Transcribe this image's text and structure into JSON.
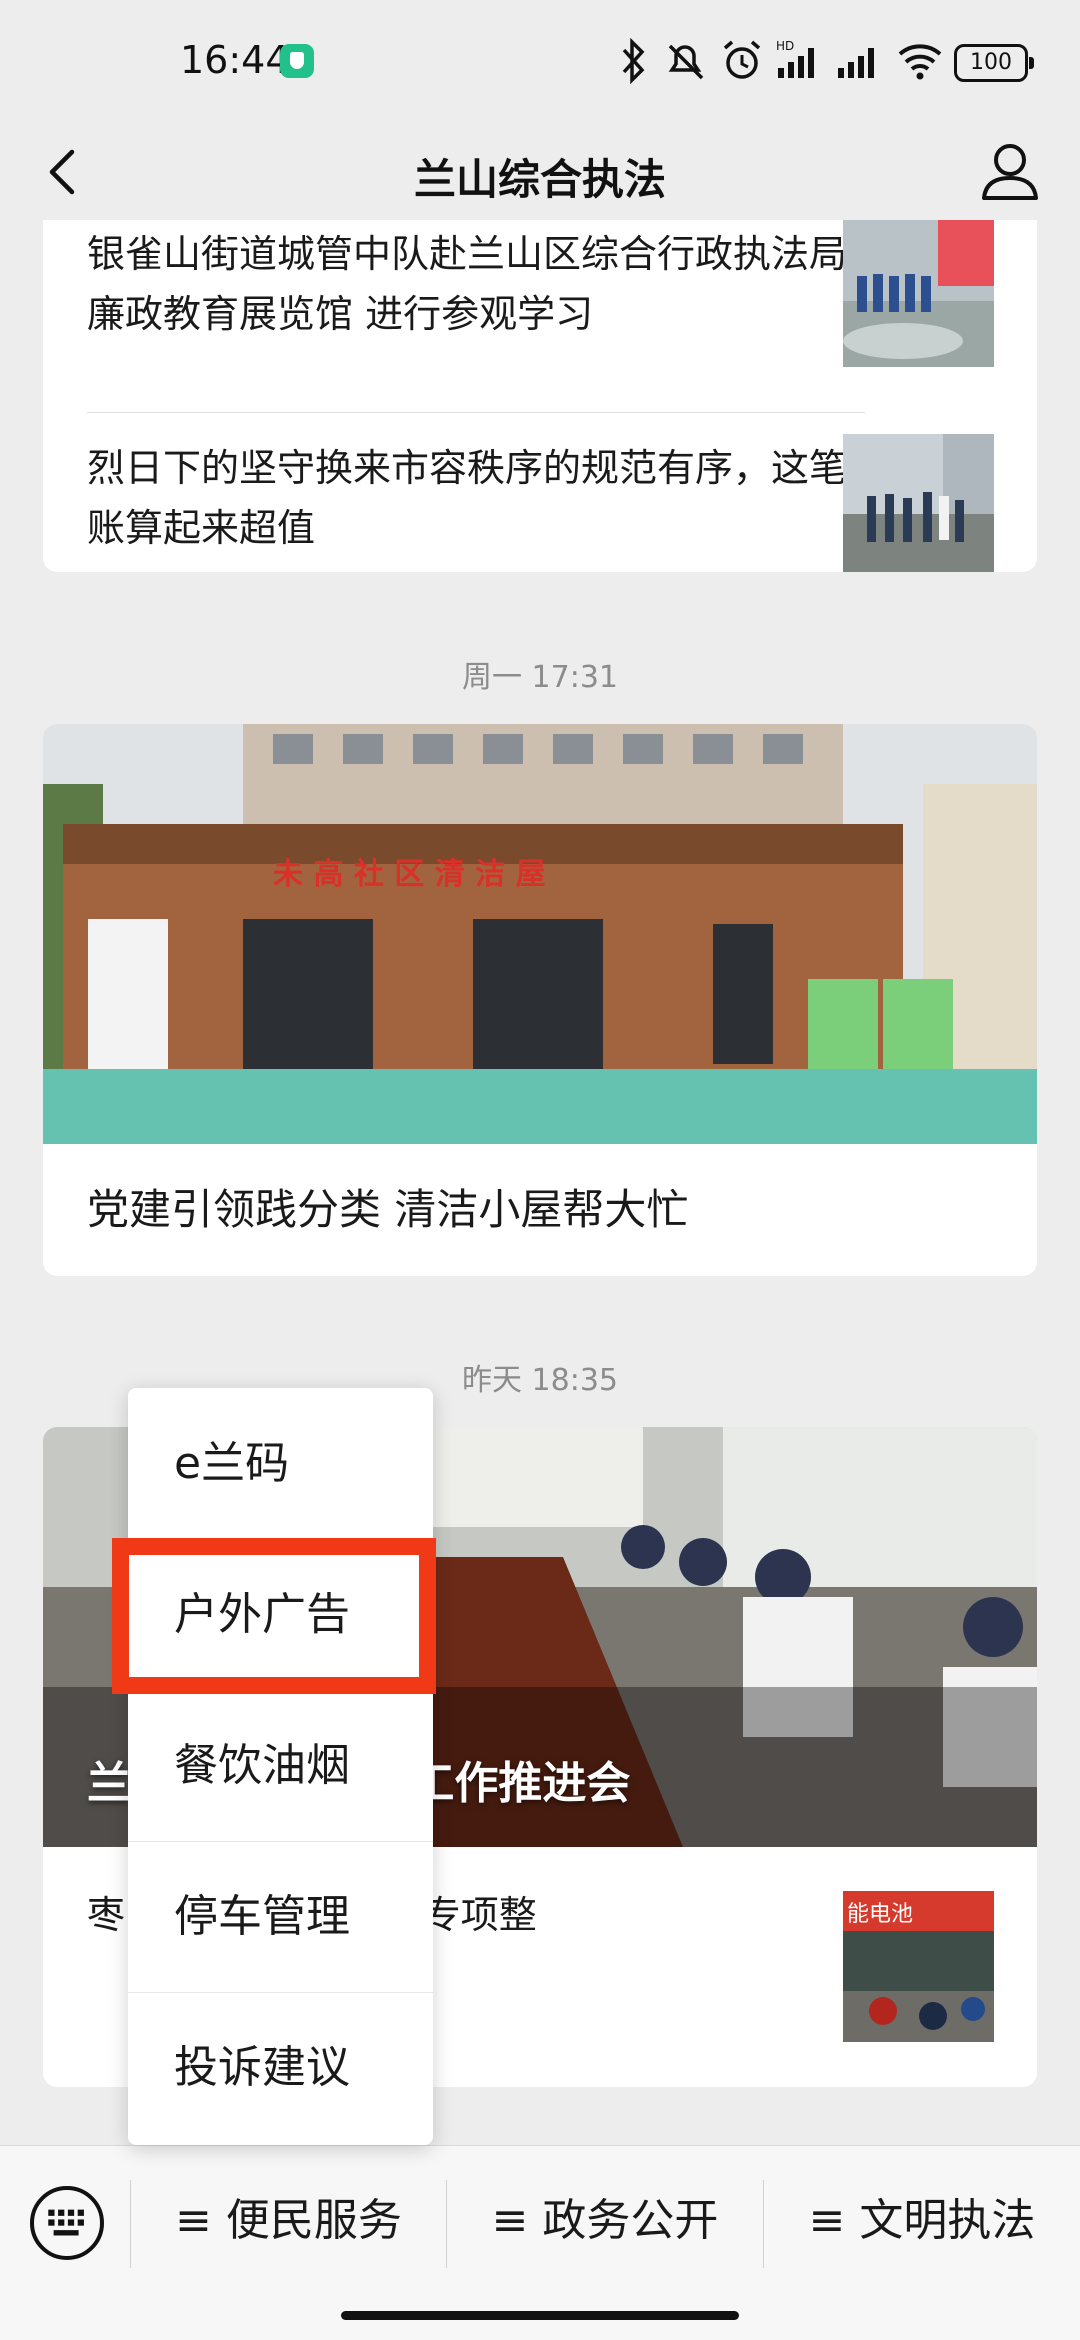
{
  "status_bar": {
    "time": "16:44",
    "battery": "100",
    "icons": [
      "bluetooth-icon",
      "mute-icon",
      "alarm-icon",
      "hd-signal-icon",
      "signal-icon",
      "wifi-icon",
      "battery-icon"
    ]
  },
  "header": {
    "title": "兰山综合执法",
    "back_icon": "back-icon",
    "profile_icon": "profile-icon"
  },
  "feed": {
    "group1": {
      "items": [
        {
          "title": "银雀山街道城管中队赴兰山区综合行政执法局廉政教育展览馆 进行参观学习"
        },
        {
          "title": "烈日下的坚守换来市容秩序的规范有序，这笔账算起来超值"
        }
      ]
    },
    "group2": {
      "timestamp": "周一 17:31",
      "cover_title": "党建引领践分类  清洁小屋帮大忙"
    },
    "group3": {
      "timestamp": "昨天 18:35",
      "cover_title": "兰                    服务中心召开工作推进会",
      "item_title": "枣                   门前五包”责任制专项整"
    }
  },
  "popup_menu": {
    "items": [
      "e兰码",
      "户外广告",
      "餐饮油烟",
      "停车管理",
      "投诉建议"
    ],
    "highlighted_index": 1,
    "highlight_color": "#f03a17"
  },
  "bottom_menu": {
    "keyboard_icon": "keyboard-icon",
    "tabs": [
      "≡ 便民服务",
      "≡ 政务公开",
      "≡ 文明执法"
    ]
  }
}
